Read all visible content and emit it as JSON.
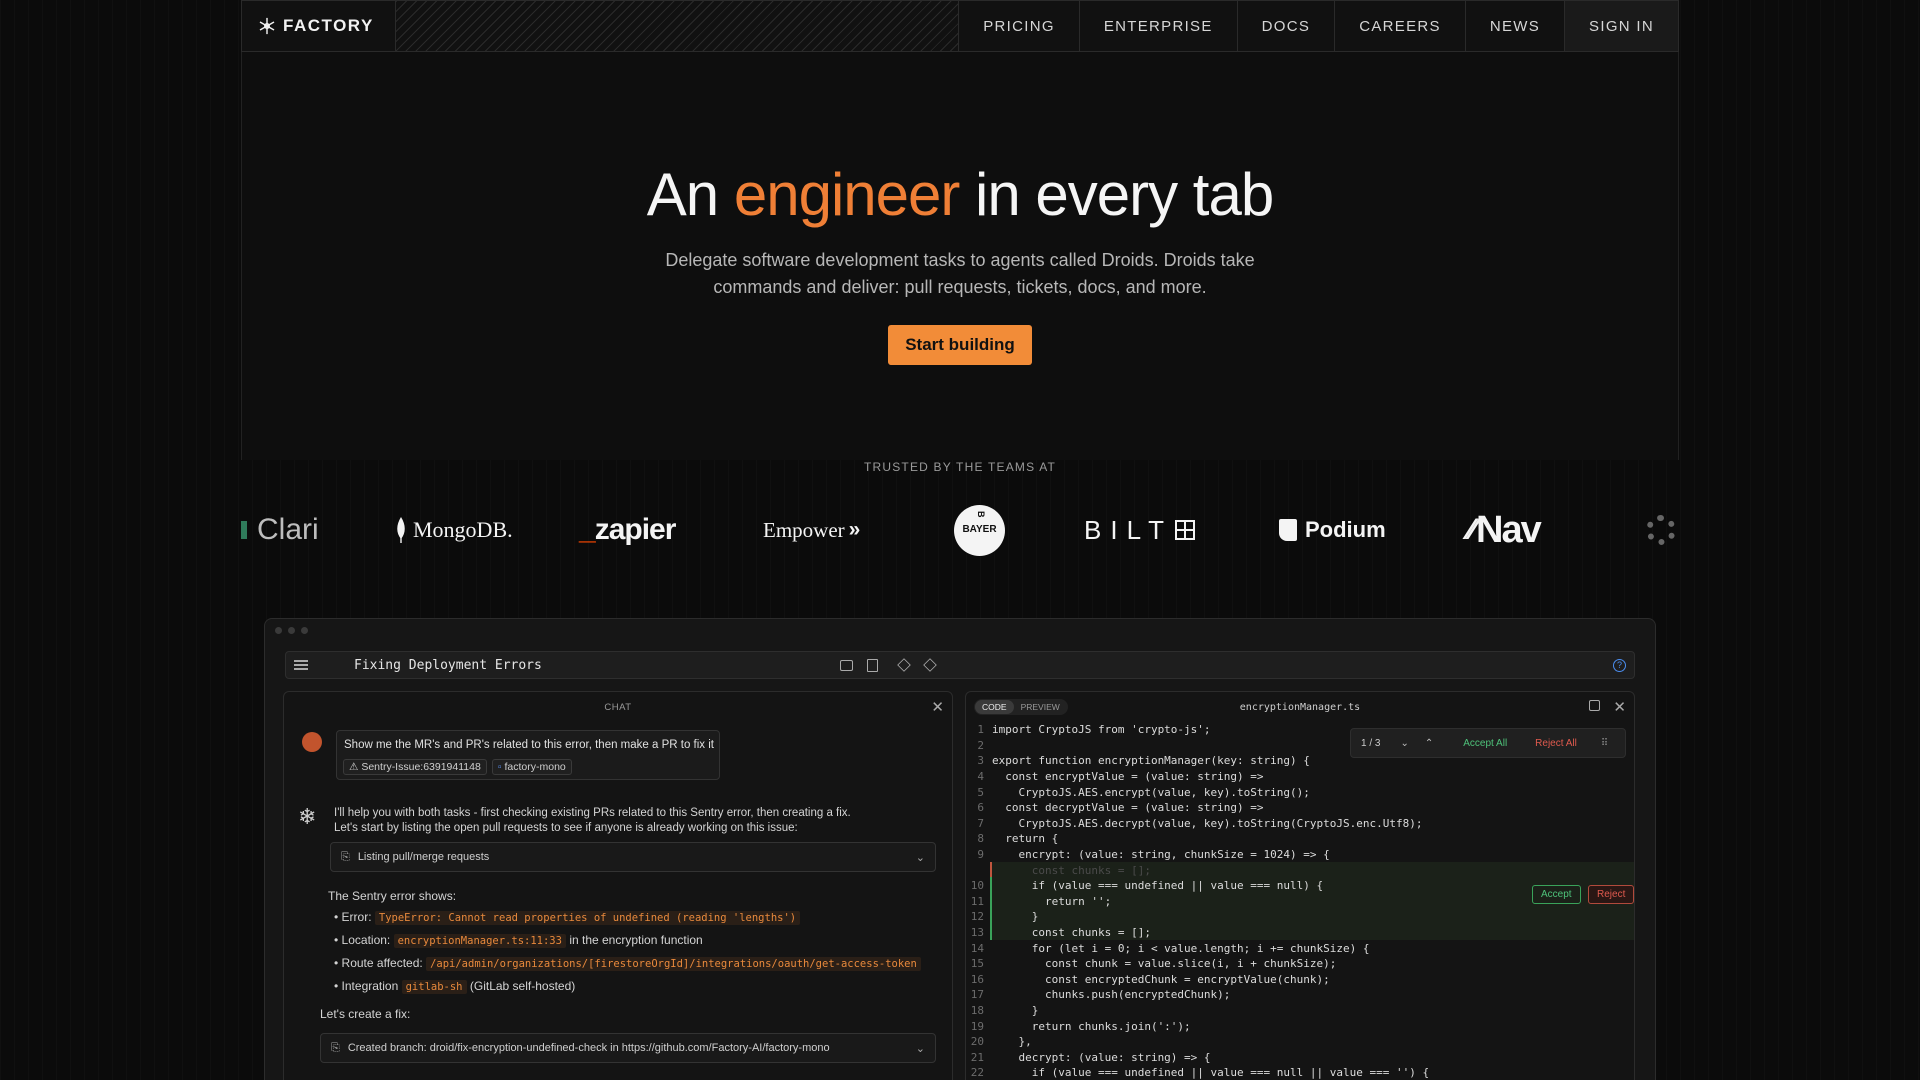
{
  "brand": {
    "name": "FACTORY",
    "logo_icon": "snowflake-icon"
  },
  "nav": {
    "items": [
      "PRICING",
      "ENTERPRISE",
      "DOCS",
      "CAREERS",
      "NEWS"
    ],
    "signin": "SIGN IN"
  },
  "hero": {
    "title_pre": "An",
    "title_accent": "engineer",
    "title_post": "in every tab",
    "subtitle": "Delegate software development tasks to agents called Droids. Droids take commands and deliver: pull requests, tickets, docs, and more.",
    "cta": "Start building",
    "accent_color": "#ef7f36"
  },
  "trusted": {
    "label": "TRUSTED BY THE TEAMS AT",
    "logos": [
      "Clari",
      "MongoDB.",
      "_zapier",
      "Empower",
      "BAYER",
      "BILT",
      "Podium",
      "Nav"
    ]
  },
  "app": {
    "title": "Fixing Deployment Errors",
    "chat": {
      "header": "CHAT",
      "user_message": "Show me the MR's and PR's related to this error, then make a PR to fix it",
      "user_tags": [
        "Sentry-Issue:6391941148",
        "factory-mono"
      ],
      "droid_message_1": "I'll help you with both tasks - first checking existing PRs related to this Sentry error, then creating a fix.",
      "droid_message_2": "Let's start by listing the open pull requests to see if anyone is already working on this issue:",
      "step_1": "Listing pull/merge requests",
      "sentry_heading": "The Sentry error shows:",
      "bullets": [
        {
          "label": "Error:",
          "chip": "TypeError: Cannot read properties of undefined (reading 'lengths')",
          "rest": ""
        },
        {
          "label": "Location:",
          "chip": "encryptionManager.ts:11:33",
          "rest": "in the encryption function"
        },
        {
          "label": "Route affected:",
          "chip": "/api/admin/organizations/[firestoreOrgId]/integrations/oauth/get-access-token",
          "rest": ""
        },
        {
          "label": "Integration",
          "chip": "gitlab-sh",
          "rest": "(GitLab self-hosted)"
        }
      ],
      "fix_heading": "Let's create a fix:",
      "step_2": "Created branch: droid/fix-encryption-undefined-check in https://github.com/Factory-AI/factory-mono"
    },
    "editor": {
      "tabs": [
        "CODE",
        "PREVIEW"
      ],
      "filename": "encryptionManager.ts",
      "diff_counter": "1 / 3",
      "accept_all": "Accept All",
      "reject_all": "Reject All",
      "accept": "Accept",
      "reject": "Reject",
      "lines": [
        {
          "n": "1",
          "t": "import CryptoJS from 'crypto-js';"
        },
        {
          "n": "2",
          "t": ""
        },
        {
          "n": "3",
          "t": "export function encryptionManager(key: string) {"
        },
        {
          "n": "4",
          "t": "  const encryptValue = (value: string) =>"
        },
        {
          "n": "5",
          "t": "    CryptoJS.AES.encrypt(value, key).toString();"
        },
        {
          "n": "6",
          "t": "  const decryptValue = (value: string) =>"
        },
        {
          "n": "7",
          "t": "    CryptoJS.AES.decrypt(value, key).toString(CryptoJS.enc.Utf8);"
        },
        {
          "n": "8",
          "t": "  return {"
        },
        {
          "n": "9",
          "t": "    encrypt: (value: string, chunkSize = 1024) => {"
        },
        {
          "n": "",
          "t": "      const chunks = [];"
        },
        {
          "n": "10",
          "t": "      if (value === undefined || value === null) {"
        },
        {
          "n": "11",
          "t": "        return '';"
        },
        {
          "n": "12",
          "t": "      }"
        },
        {
          "n": "13",
          "t": "      const chunks = [];"
        },
        {
          "n": "14",
          "t": "      for (let i = 0; i < value.length; i += chunkSize) {"
        },
        {
          "n": "15",
          "t": "        const chunk = value.slice(i, i + chunkSize);"
        },
        {
          "n": "16",
          "t": "        const encryptedChunk = encryptValue(chunk);"
        },
        {
          "n": "17",
          "t": "        chunks.push(encryptedChunk);"
        },
        {
          "n": "18",
          "t": "      }"
        },
        {
          "n": "19",
          "t": "      return chunks.join(':');"
        },
        {
          "n": "20",
          "t": "    },"
        },
        {
          "n": "21",
          "t": "    decrypt: (value: string) => {"
        },
        {
          "n": "22",
          "t": "      if (value === undefined || value === null || value === '') {"
        }
      ]
    }
  }
}
